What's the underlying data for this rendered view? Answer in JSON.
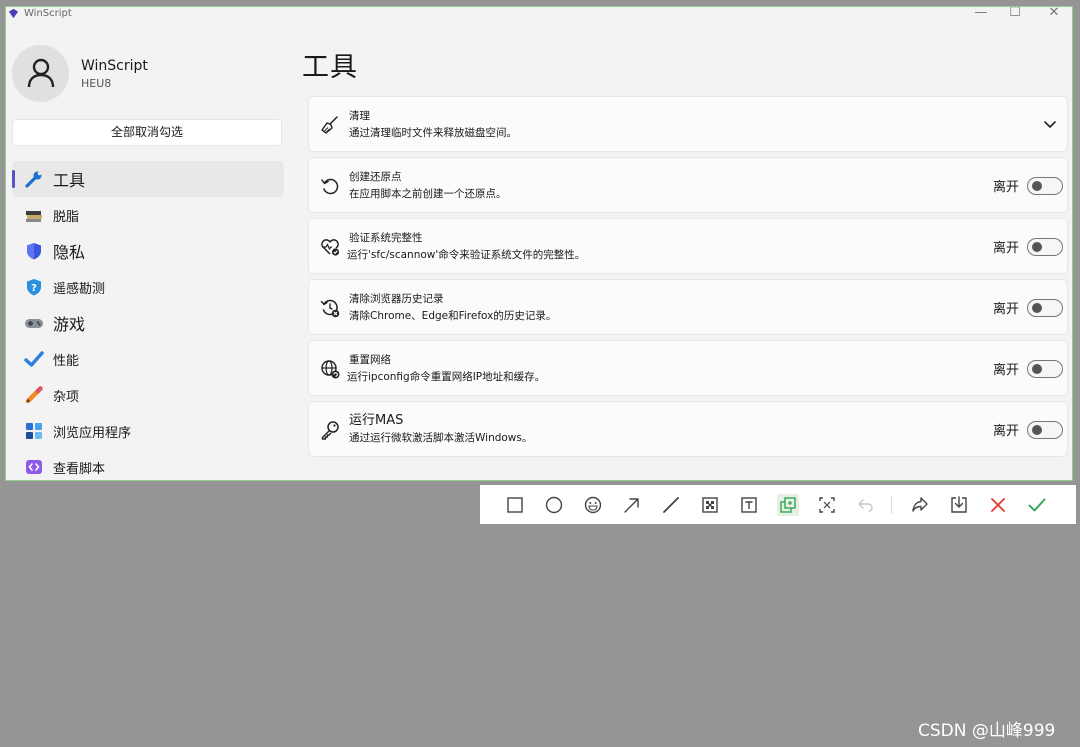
{
  "window": {
    "title": "WinScript",
    "controls": [
      "—",
      "☐",
      "✕"
    ]
  },
  "user": {
    "name": "WinScript",
    "subtitle": "HEU8",
    "toggle_all_label": "全部取消勾选"
  },
  "nav": {
    "items": [
      {
        "label": "工具",
        "icon": "wrench-icon",
        "active": true
      },
      {
        "label": "脱脂",
        "icon": "books-icon"
      },
      {
        "label": "隐私",
        "icon": "shield-icon"
      },
      {
        "label": "遥感勘测",
        "icon": "shield-question-icon"
      },
      {
        "label": "游戏",
        "icon": "gamepad-icon"
      },
      {
        "label": "性能",
        "icon": "checkmark-icon"
      },
      {
        "label": "杂项",
        "icon": "pencil-icon"
      },
      {
        "label": "浏览应用程序",
        "icon": "apps-icon"
      },
      {
        "label": "查看脚本",
        "icon": "code-icon"
      }
    ]
  },
  "main": {
    "title": "工具",
    "cards": [
      {
        "title": "清理",
        "desc": "通过清理临时文件来释放磁盘空间。",
        "icon": "broom-icon",
        "expandable": true
      },
      {
        "title": "创建还原点",
        "desc": "在应用脚本之前创建一个还原点。",
        "icon": "restore-icon",
        "state": "离开"
      },
      {
        "title": "验证系统完整性",
        "desc": "运行'sfc/scannow'命令来验证系统文件的完整性。",
        "icon": "heart-check-icon",
        "state": "离开"
      },
      {
        "title": "清除浏览器历史记录",
        "desc": "清除Chrome、Edge和Firefox的历史记录。",
        "icon": "history-clear-icon",
        "state": "离开"
      },
      {
        "title": "重置网络",
        "desc": "运行ipconfig命令重置网络IP地址和缓存。",
        "icon": "globe-reset-icon",
        "state": "离开"
      },
      {
        "title": "运行MAS",
        "desc": "通过运行微软激活脚本激活Windows。",
        "icon": "key-icon",
        "state": "离开"
      }
    ]
  },
  "snip_toolbar": {
    "tools": [
      "rectangle-icon",
      "ellipse-icon",
      "emoji-icon",
      "arrow-icon",
      "line-icon",
      "mosaic-icon",
      "text-icon",
      "copy-icon",
      "ocr-icon",
      "undo-icon",
      "share-icon",
      "save-icon",
      "cancel-icon",
      "confirm-icon"
    ],
    "accent_cancel": "#e53935",
    "accent_confirm": "#2fa84f"
  },
  "watermark": "CSDN @山峰999",
  "colors": {
    "accent": "#5b4fc4",
    "window_border": "#8fcf8a"
  }
}
